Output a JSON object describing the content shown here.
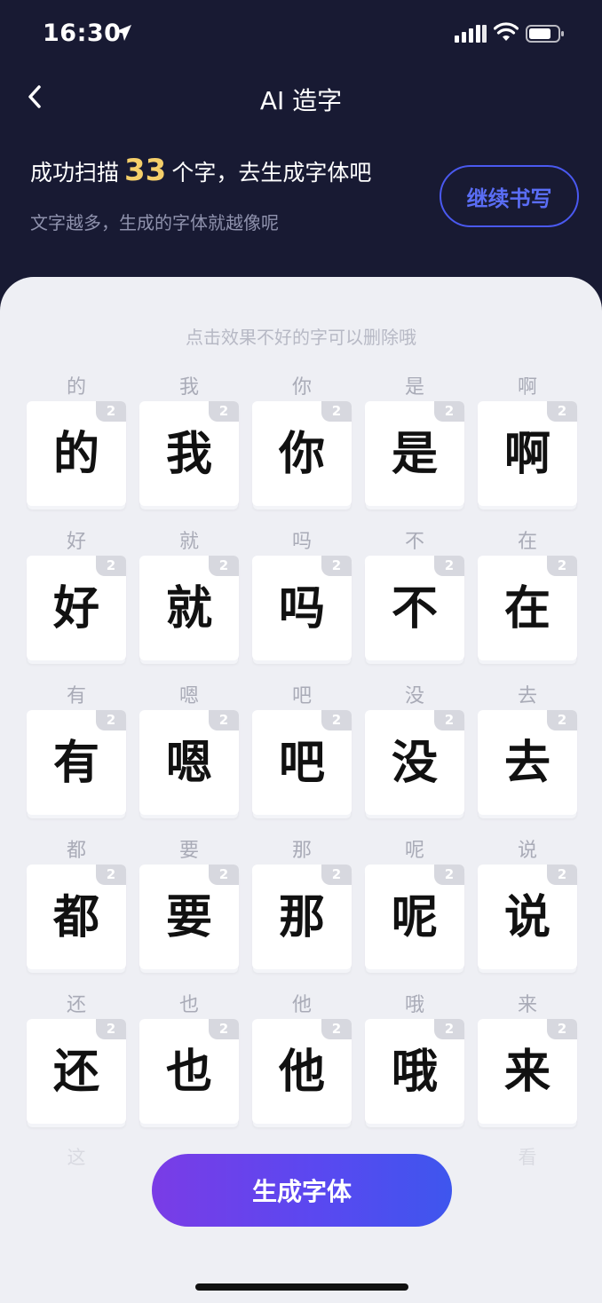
{
  "status_bar": {
    "time": "16:30"
  },
  "nav": {
    "title": "AI 造字"
  },
  "header": {
    "scan_prefix": "成功扫描",
    "scan_count": "33",
    "scan_suffix": "个字，去生成字体吧",
    "hint": "文字越多，生成的字体就越像呢",
    "continue_label": "继续书写"
  },
  "panel": {
    "tip": "点击效果不好的字可以删除哦",
    "characters": [
      {
        "label": "的",
        "count": "2"
      },
      {
        "label": "我",
        "count": "2"
      },
      {
        "label": "你",
        "count": "2"
      },
      {
        "label": "是",
        "count": "2"
      },
      {
        "label": "啊",
        "count": "2"
      },
      {
        "label": "好",
        "count": "2"
      },
      {
        "label": "就",
        "count": "2"
      },
      {
        "label": "吗",
        "count": "2"
      },
      {
        "label": "不",
        "count": "2"
      },
      {
        "label": "在",
        "count": "2"
      },
      {
        "label": "有",
        "count": "2"
      },
      {
        "label": "嗯",
        "count": "2"
      },
      {
        "label": "吧",
        "count": "2"
      },
      {
        "label": "没",
        "count": "2"
      },
      {
        "label": "去",
        "count": "2"
      },
      {
        "label": "都",
        "count": "2"
      },
      {
        "label": "要",
        "count": "2"
      },
      {
        "label": "那",
        "count": "2"
      },
      {
        "label": "呢",
        "count": "2"
      },
      {
        "label": "说",
        "count": "2"
      },
      {
        "label": "还",
        "count": "2"
      },
      {
        "label": "也",
        "count": "2"
      },
      {
        "label": "他",
        "count": "2"
      },
      {
        "label": "哦",
        "count": "2"
      },
      {
        "label": "来",
        "count": "2"
      }
    ],
    "peek_labels": [
      "这",
      "",
      "",
      "",
      "看"
    ]
  },
  "generate_label": "生成字体",
  "colors": {
    "header_bg": "#181a33",
    "panel_bg": "#eeeff4",
    "accent": "#4a59f0",
    "count_highlight": "#f5cf6a"
  }
}
